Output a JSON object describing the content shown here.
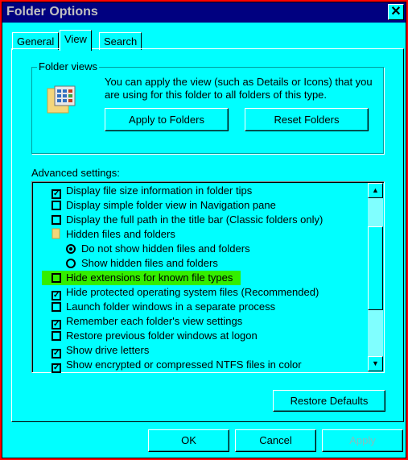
{
  "window": {
    "title": "Folder Options",
    "close_icon": "close-icon"
  },
  "tabs": [
    {
      "label": "General"
    },
    {
      "label": "View",
      "active": true
    },
    {
      "label": "Search"
    }
  ],
  "folder_views": {
    "label": "Folder views",
    "description": "You can apply the view (such as Details or Icons) that you are using for this folder to all folders of this type.",
    "apply_label": "Apply to Folders",
    "reset_label": "Reset Folders"
  },
  "advanced": {
    "label": "Advanced settings:",
    "items": [
      {
        "type": "checkbox",
        "checked": true,
        "label": "Display file size information in folder tips"
      },
      {
        "type": "checkbox",
        "checked": false,
        "label": "Display simple folder view in Navigation pane"
      },
      {
        "type": "checkbox",
        "checked": false,
        "label": "Display the full path in the title bar (Classic folders only)"
      },
      {
        "type": "folder",
        "label": "Hidden files and folders"
      },
      {
        "type": "radio",
        "checked": true,
        "label": "Do not show hidden files and folders"
      },
      {
        "type": "radio",
        "checked": false,
        "label": "Show hidden files and folders"
      },
      {
        "type": "checkbox",
        "checked": false,
        "label": "Hide extensions for known file types",
        "highlighted": true
      },
      {
        "type": "checkbox",
        "checked": true,
        "label": "Hide protected operating system files (Recommended)"
      },
      {
        "type": "checkbox",
        "checked": false,
        "label": "Launch folder windows in a separate process"
      },
      {
        "type": "checkbox",
        "checked": true,
        "label": "Remember each folder's view settings"
      },
      {
        "type": "checkbox",
        "checked": false,
        "label": "Restore previous folder windows at logon"
      },
      {
        "type": "checkbox",
        "checked": true,
        "label": "Show drive letters"
      },
      {
        "type": "checkbox",
        "checked": true,
        "label": "Show encrypted or compressed NTFS files in color"
      }
    ],
    "restore_label": "Restore Defaults"
  },
  "footer": {
    "ok_label": "OK",
    "cancel_label": "Cancel",
    "apply_label": "Apply",
    "apply_disabled": true
  },
  "colors": {
    "background": "#00ffff",
    "titlebar": "#000080",
    "highlight": "#33ee00",
    "frame": "#ff0000"
  }
}
